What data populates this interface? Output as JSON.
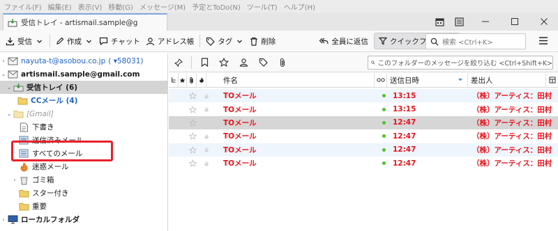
{
  "menu": [
    "ファイル(F)",
    "編集(E)",
    "表示(V)",
    "移動(G)",
    "メッセージ(M)",
    "予定とToDo(N)",
    "ツール(T)",
    "ヘルプ(H)"
  ],
  "tab": {
    "label": "受信トレイ - artismail.sample@g"
  },
  "toolbar": {
    "receive": "受信",
    "compose": "作成",
    "chat": "チャット",
    "address_book": "アドレス帳",
    "tag": "タグ",
    "delete": "削除",
    "reply_all": "全員に返信",
    "quick_filter": "クイックフィルター",
    "search_placeholder": "検索 <Ctrl+K>"
  },
  "folders": {
    "account1": "nayuta-t@asobou.co.jp",
    "account1_badge": "( ▾58031)",
    "account2": "artismail.sample@gmail.com",
    "inbox": "受信トレイ (6)",
    "cc": "CCメール (4)",
    "gmail": "[Gmail]",
    "drafts": "下書き",
    "sent": "送信済みメール",
    "all": "すべてのメール",
    "spam": "迷惑メール",
    "trash": "ゴミ箱",
    "starred": "スター付き",
    "important": "重要",
    "local": "ローカルフォルダ"
  },
  "filter": {
    "placeholder": "このフォルダーのメッセージを絞り込む <Ctrl+Shift+K>"
  },
  "columns": {
    "subject": "件名",
    "date": "送信日時",
    "sender": "差出人"
  },
  "messages": [
    {
      "subject": "TOメール",
      "date": "13:15",
      "sender": "（株）アーティス：田村"
    },
    {
      "subject": "TOメール",
      "date": "13:15",
      "sender": "（株）アーティス：田村"
    },
    {
      "subject": "TOメール",
      "date": "12:47",
      "sender": "（株）アーティス：田村"
    },
    {
      "subject": "TOメール",
      "date": "12:47",
      "sender": "（株）アーティス：田村"
    },
    {
      "subject": "TOメール",
      "date": "12:47",
      "sender": "（株）アーティス：田村"
    },
    {
      "subject": "TOメール",
      "date": "12:47",
      "sender": "（株）アーティス：田村"
    }
  ],
  "selected_row": 2,
  "colors": {
    "accent": "#0a84ff",
    "highlight": "#e8202a",
    "unread": "#e8131b",
    "online": "#4fc12b"
  }
}
